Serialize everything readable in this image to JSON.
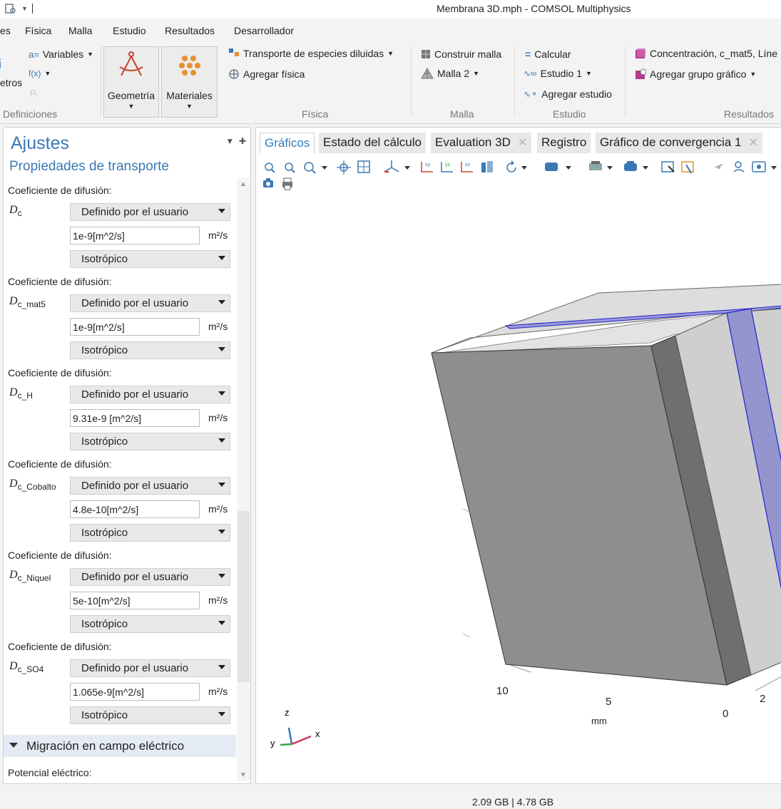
{
  "window": {
    "title": "Membrana 3D.mph - COMSOL Multiphysics"
  },
  "menu": {
    "items": [
      "es",
      "Física",
      "Malla",
      "Estudio",
      "Resultados",
      "Desarrollador"
    ]
  },
  "ribbon": {
    "definitions": {
      "variables": "Variables",
      "fx": "f(x)",
      "pi": "Pᵢ",
      "params_partial": "etros",
      "label": "Definiciones"
    },
    "geometry": "Geometría",
    "materials": "Materiales",
    "physics": {
      "transport": "Transporte de especies diluidas",
      "add_physics": "Agregar física",
      "label": "Física"
    },
    "mesh": {
      "build": "Construir malla",
      "mesh2": "Malla 2",
      "label": "Malla"
    },
    "study": {
      "compute": "Calcular",
      "study1": "Estudio 1",
      "add_study": "Agregar estudio",
      "label": "Estudio"
    },
    "results": {
      "concentration": "Concentración, c_mat5, Líne",
      "add_plot_group": "Agregar grupo gráfico",
      "label": "Resultados"
    }
  },
  "settings": {
    "title": "Ajustes",
    "subtitle": "Propiedades de transporte",
    "coef_label": "Coeficiente de difusión:",
    "rows": [
      {
        "sym": "D",
        "sub": "c",
        "mode": "Definido por el usuario",
        "value": "1e-9[m^2/s]",
        "unit": "m²/s",
        "aniso": "Isotrópico"
      },
      {
        "sym": "D",
        "sub": "c_mat5",
        "mode": "Definido por el usuario",
        "value": "1e-9[m^2/s]",
        "unit": "m²/s",
        "aniso": "Isotrópico"
      },
      {
        "sym": "D",
        "sub": "c_H",
        "mode": "Definido por el usuario",
        "value": "9.31e-9 [m^2/s]",
        "unit": "m²/s",
        "aniso": "Isotrópico"
      },
      {
        "sym": "D",
        "sub": "c_Cobalto",
        "mode": "Definido por el usuario",
        "value": "4.8e-10[m^2/s]",
        "unit": "m²/s",
        "aniso": "Isotrópico"
      },
      {
        "sym": "D",
        "sub": "c_Niquel",
        "mode": "Definido por el usuario",
        "value": "5e-10[m^2/s]",
        "unit": "m²/s",
        "aniso": "Isotrópico"
      },
      {
        "sym": "D",
        "sub": "c_SO4",
        "mode": "Definido por el usuario",
        "value": "1.065e-9[m^2/s]",
        "unit": "m²/s",
        "aniso": "Isotrópico"
      }
    ],
    "section": "Migración en campo eléctrico",
    "potential_label": "Potencial eléctrico:"
  },
  "graphics": {
    "tabs": [
      "Gráficos",
      "Estado del cálculo",
      "Evaluation 3D",
      "Registro",
      "Gráfico de convergencia 1"
    ],
    "axis_ticks": [
      "10",
      "5",
      "0",
      "2"
    ],
    "axis_unit": "mm",
    "triad": {
      "x": "x",
      "y": "y",
      "z": "z"
    }
  },
  "status": {
    "memory": "2.09 GB | 4.78 GB"
  },
  "colors": {
    "accent": "#3a78b5",
    "highlight": "#8f8fd0"
  }
}
